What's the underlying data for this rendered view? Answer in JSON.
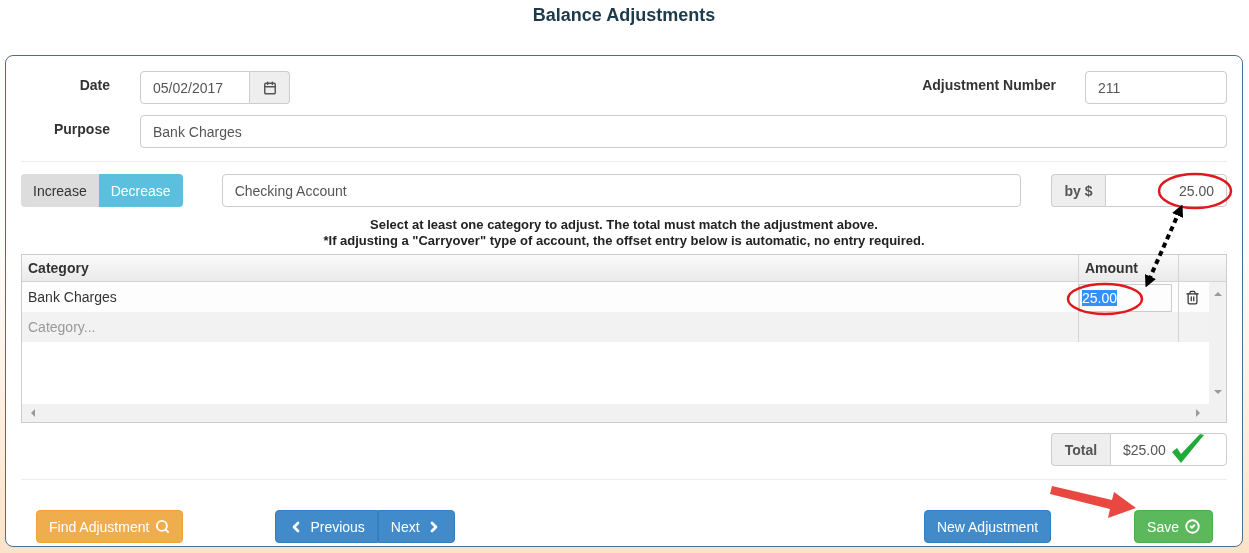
{
  "title": "Balance Adjustments",
  "date": {
    "label": "Date",
    "value": "05/02/2017"
  },
  "adjustment_number": {
    "label": "Adjustment Number",
    "value": "211"
  },
  "purpose": {
    "label": "Purpose",
    "value": "Bank Charges"
  },
  "direction": [
    {
      "label": "Increase",
      "selected": false
    },
    {
      "label": "Decrease",
      "selected": true
    }
  ],
  "account": {
    "value": "Checking Account"
  },
  "amount": {
    "addon": "by $",
    "value": "25.00"
  },
  "notes": [
    "Select at least one category to adjust. The total must match the adjustment above.",
    "*If adjusting a \"Carryover\" type of account, the offset entry below is automatic, no entry required."
  ],
  "table": {
    "columns": [
      "Category",
      "Amount"
    ],
    "rows": [
      {
        "category": "Bank Charges",
        "amount": "25.00",
        "highlighted": true
      }
    ],
    "new_row": {
      "placeholder": "Category..."
    }
  },
  "total": {
    "label": "Total",
    "value": "$25.00"
  },
  "buttons": {
    "find": "Find Adjustment",
    "previous": "Previous",
    "next": "Next",
    "new": "New Adjustment",
    "save": "Save"
  }
}
